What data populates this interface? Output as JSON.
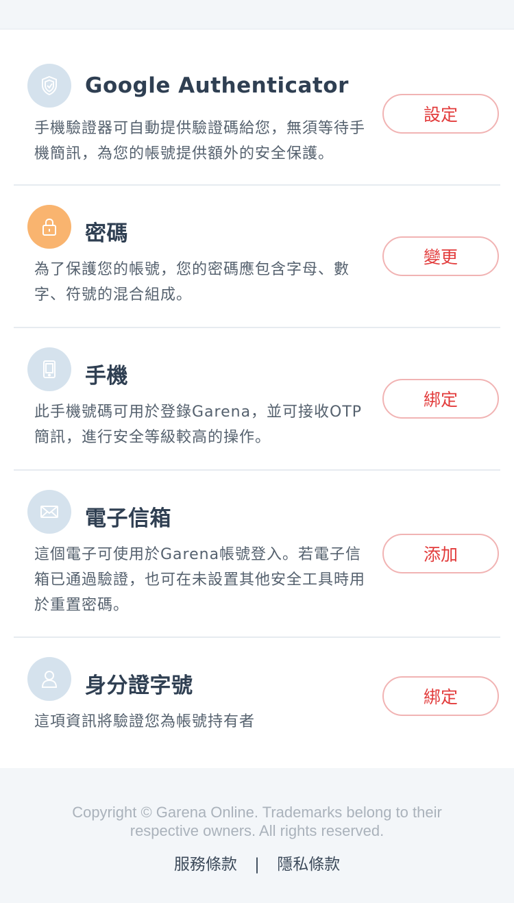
{
  "sections": [
    {
      "title": "Google Authenticator",
      "description": "手機驗證器可自動提供驗證碼給您，無須等待手機簡訊，為您的帳號提供額外的安全保護。",
      "button": "設定",
      "icon": "shield-icon"
    },
    {
      "title": "密碼",
      "description": "為了保護您的帳號，您的密碼應包含字母、數字、符號的混合組成。",
      "button": "變更",
      "icon": "lock-icon"
    },
    {
      "title": "手機",
      "description": "此手機號碼可用於登錄Garena，並可接收OTP簡訊，進行安全等級較高的操作。",
      "button": "綁定",
      "icon": "phone-icon"
    },
    {
      "title": "電子信箱",
      "description": "這個電子可使用於Garena帳號登入。若電子信箱已通過驗證，也可在未設置其他安全工具時用於重置密碼。",
      "button": "添加",
      "icon": "envelope-icon"
    },
    {
      "title": "身分證字號",
      "description": "這項資訊將驗證您為帳號持有者",
      "button": "綁定",
      "icon": "user-icon"
    }
  ],
  "footer": {
    "copyright": "Copyright © Garena Online. Trademarks belong to their respective owners. All rights reserved.",
    "terms": "服務條款",
    "separator": "|",
    "privacy": "隱私條款"
  },
  "colors": {
    "accent_red": "#e23b3b",
    "button_border": "#f1b3b3",
    "icon_bg": "#d5e2ed",
    "icon_bg_active": "#f9b46f"
  }
}
